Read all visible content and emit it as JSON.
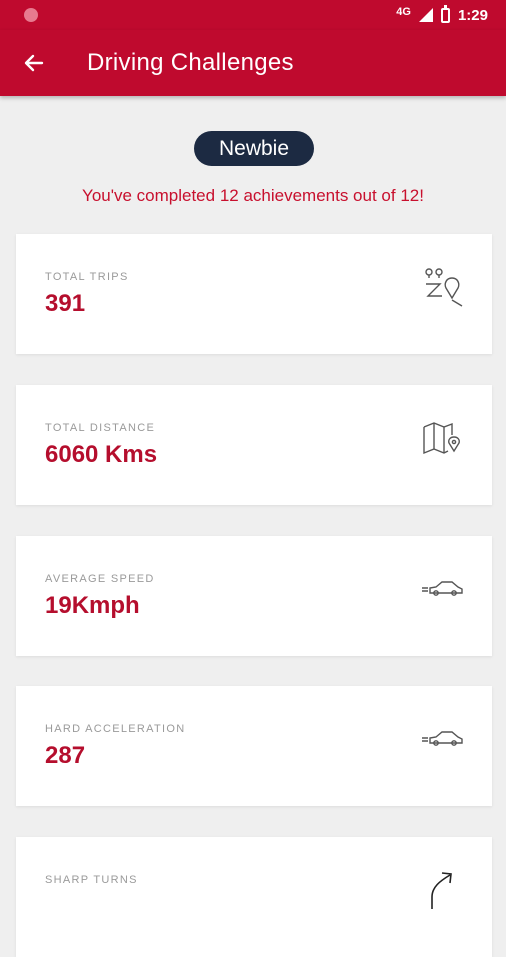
{
  "status_bar": {
    "network": "4G",
    "time": "1:29"
  },
  "app_bar": {
    "title": "Driving Challenges"
  },
  "level_badge": "Newbie",
  "summary": "You've completed 12 achievements out of 12!",
  "stats": [
    {
      "label": "TOTAL TRIPS",
      "value": "391",
      "icon": "route-pins-icon"
    },
    {
      "label": "TOTAL DISTANCE",
      "value": "6060 Kms",
      "icon": "map-pin-icon"
    },
    {
      "label": "AVERAGE SPEED",
      "value": "19Kmph",
      "icon": "car-speed-icon"
    },
    {
      "label": "HARD ACCELERATION",
      "value": "287",
      "icon": "car-acceleration-icon"
    },
    {
      "label": "SHARP TURNS",
      "value": "",
      "icon": "turn-arrow-icon"
    }
  ],
  "colors": {
    "brand_red": "#bf0a2e",
    "badge_navy": "#1c2a42",
    "value_red": "#b50e2d",
    "background": "#efefef"
  }
}
